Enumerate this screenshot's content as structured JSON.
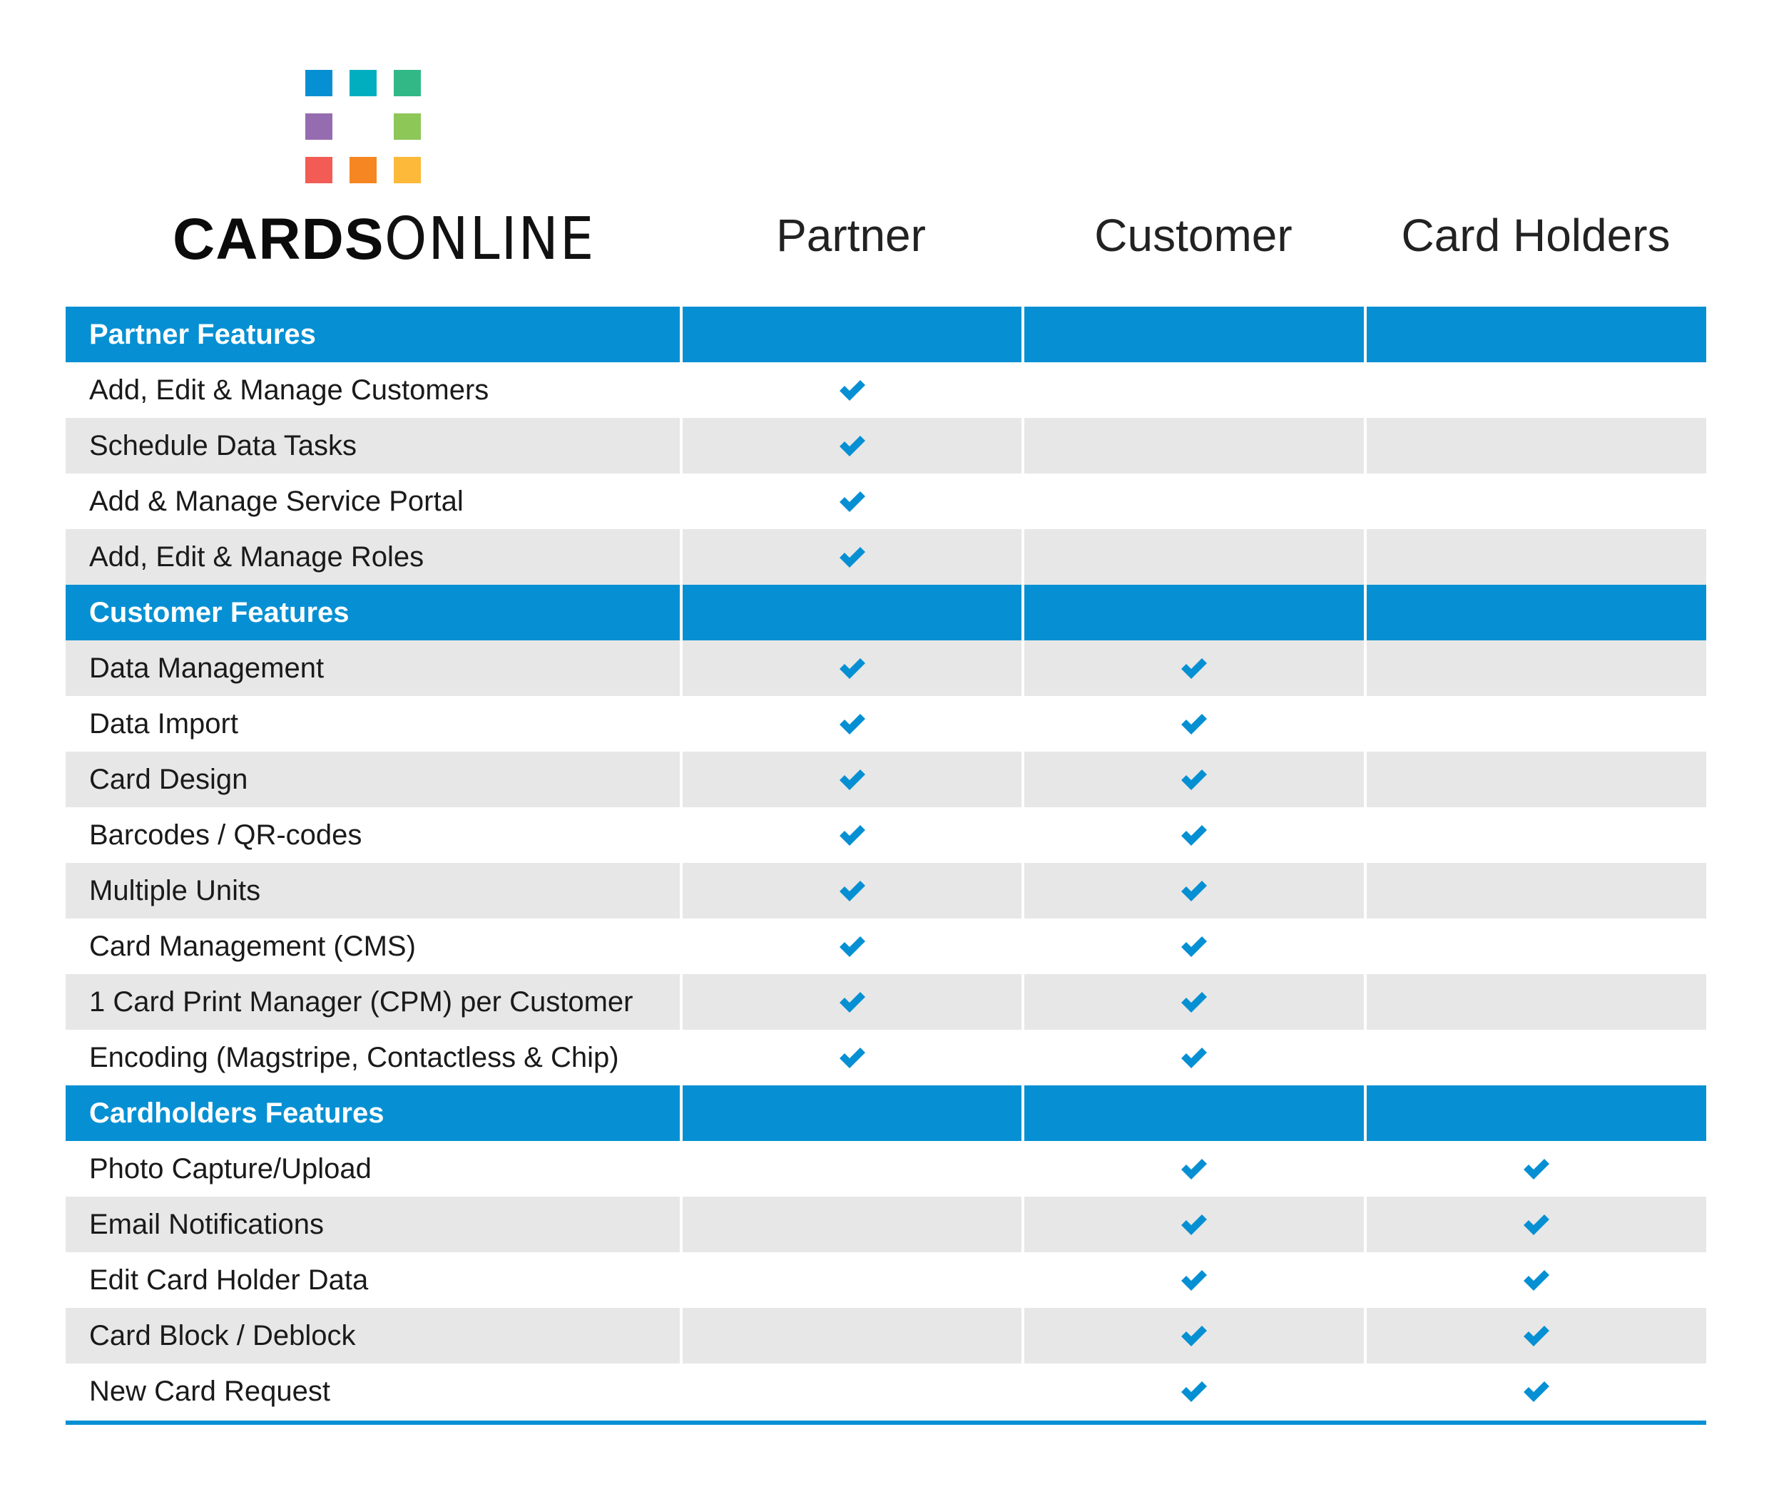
{
  "brand": {
    "name_bold": "CARDS",
    "name_light": "ONLINE",
    "logo_colors": [
      "#0690d3",
      "#00aec0",
      "#32b886",
      "#966cb0",
      null,
      "#8dc757",
      "#f25c54",
      "#f58622",
      "#fdb93a"
    ]
  },
  "columns": [
    "Partner",
    "Customer",
    "Card Holders"
  ],
  "accent_color": "#0690d3",
  "check_icon": "check-icon",
  "sections": [
    {
      "title": "Partner Features",
      "rows": [
        {
          "label": "Add, Edit & Manage Customers",
          "partner": true,
          "customer": false,
          "card_holders": false
        },
        {
          "label": "Schedule Data Tasks",
          "partner": true,
          "customer": false,
          "card_holders": false
        },
        {
          "label": "Add & Manage Service Portal",
          "partner": true,
          "customer": false,
          "card_holders": false
        },
        {
          "label": "Add, Edit & Manage Roles",
          "partner": true,
          "customer": false,
          "card_holders": false
        }
      ]
    },
    {
      "title": "Customer Features",
      "rows": [
        {
          "label": "Data Management",
          "partner": true,
          "customer": true,
          "card_holders": false
        },
        {
          "label": "Data Import",
          "partner": true,
          "customer": true,
          "card_holders": false
        },
        {
          "label": "Card Design",
          "partner": true,
          "customer": true,
          "card_holders": false
        },
        {
          "label": "Barcodes / QR-codes",
          "partner": true,
          "customer": true,
          "card_holders": false
        },
        {
          "label": "Multiple Units",
          "partner": true,
          "customer": true,
          "card_holders": false
        },
        {
          "label": "Card Management (CMS)",
          "partner": true,
          "customer": true,
          "card_holders": false
        },
        {
          "label": "1 Card Print Manager (CPM) per Customer",
          "partner": true,
          "customer": true,
          "card_holders": false
        },
        {
          "label": "Encoding (Magstripe, Contactless & Chip)",
          "partner": true,
          "customer": true,
          "card_holders": false
        }
      ]
    },
    {
      "title": "Cardholders Features",
      "rows": [
        {
          "label": "Photo Capture/Upload",
          "partner": false,
          "customer": true,
          "card_holders": true
        },
        {
          "label": "Email Notifications",
          "partner": false,
          "customer": true,
          "card_holders": true
        },
        {
          "label": "Edit Card Holder Data",
          "partner": false,
          "customer": true,
          "card_holders": true
        },
        {
          "label": "Card Block / Deblock",
          "partner": false,
          "customer": true,
          "card_holders": true
        },
        {
          "label": "New Card Request",
          "partner": false,
          "customer": true,
          "card_holders": true
        }
      ]
    }
  ]
}
